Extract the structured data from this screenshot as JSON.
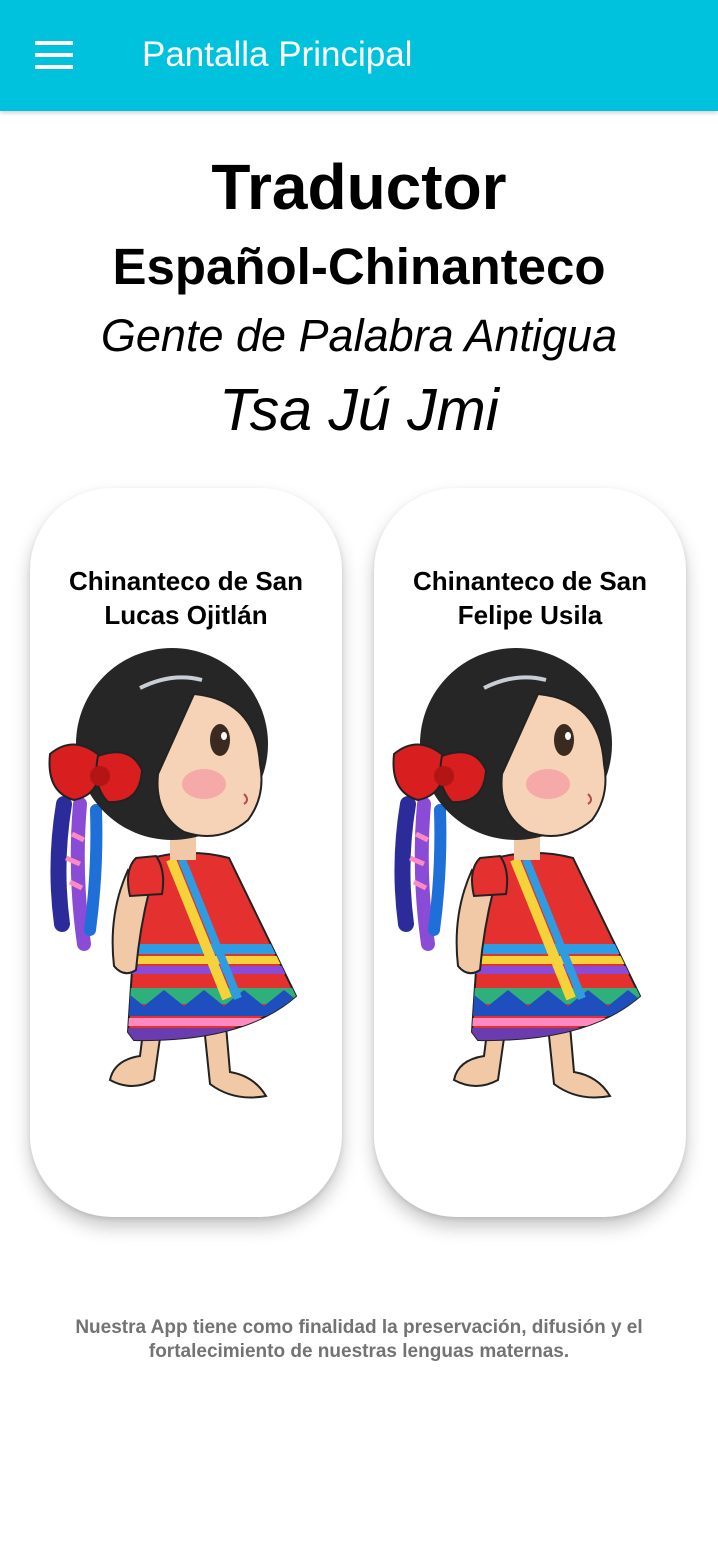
{
  "appbar": {
    "menu_icon": "hamburger-menu-icon",
    "title": "Pantalla Principal",
    "background": "#00c2dc"
  },
  "header": {
    "title": "Traductor",
    "subtitle": "Español-Chinanteco",
    "tagline": "Gente de Palabra Antigua",
    "native_name": "Tsa Jú Jmi"
  },
  "cards": [
    {
      "label": "Chinanteco de San Lucas Ojitlán",
      "image": "chinantec-girl-illustration"
    },
    {
      "label": "Chinanteco de San Felipe Usila",
      "image": "chinantec-girl-illustration"
    }
  ],
  "footer": {
    "text": "Nuestra App tiene como finalidad la preservación, difusión y el fortalecimiento de nuestras lenguas maternas."
  }
}
